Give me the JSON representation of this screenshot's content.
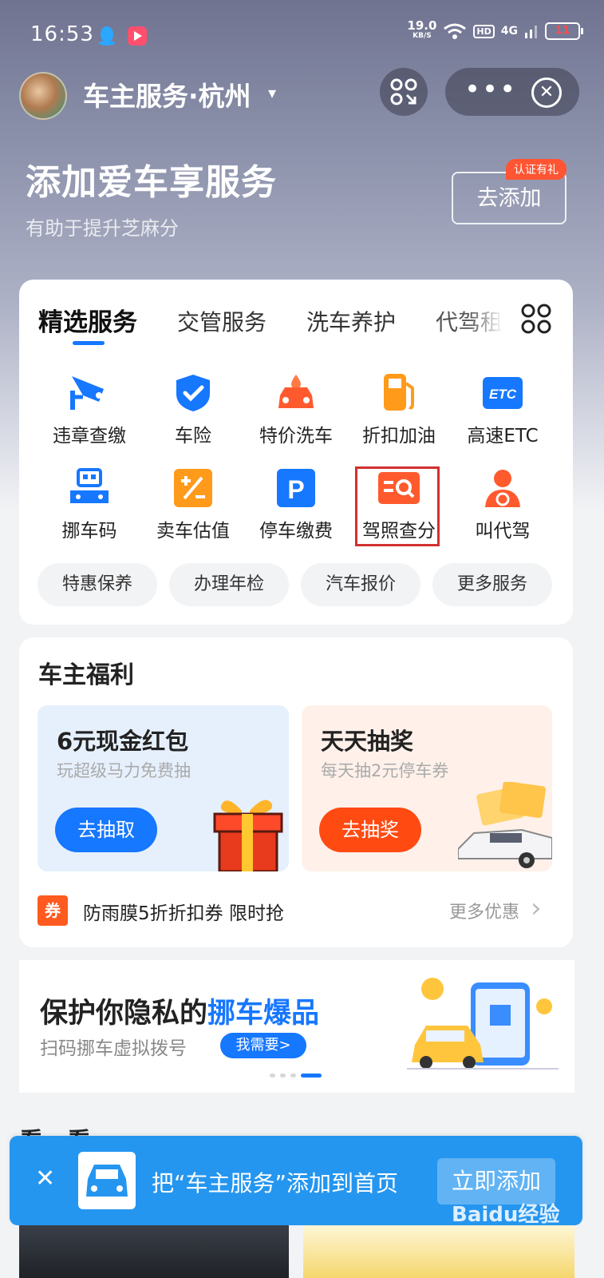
{
  "status_bar": {
    "time": "16:53",
    "net_speed": "19.0",
    "net_unit": "KB/S",
    "hd": "HD",
    "signal": "4G",
    "battery": "11"
  },
  "header": {
    "title": "车主服务·杭州",
    "caret": "▾",
    "more_label": "•••",
    "close_label": "✕"
  },
  "hero": {
    "title": "添加爱车享服务",
    "subtitle": "有助于提升芝麻分",
    "add_button": "去添加",
    "badge": "认证有礼"
  },
  "services_card": {
    "tabs": [
      {
        "label": "精选服务",
        "active": true
      },
      {
        "label": "交管服务",
        "active": false
      },
      {
        "label": "洗车养护",
        "active": false
      },
      {
        "label": "代驾租",
        "active": false
      }
    ],
    "services": [
      {
        "label": "违章查缴",
        "icon": "camera-icon",
        "color": "#1677ff"
      },
      {
        "label": "车险",
        "icon": "shield-check-icon",
        "color": "#1677ff"
      },
      {
        "label": "特价洗车",
        "icon": "car-wash-icon",
        "color": "#ff5a2e"
      },
      {
        "label": "折扣加油",
        "icon": "fuel-pump-icon",
        "color": "#ff9a1a"
      },
      {
        "label": "高速ETC",
        "icon": "etc-icon",
        "color": "#1677ff"
      },
      {
        "label": "挪车码",
        "icon": "car-qr-icon",
        "color": "#1677ff"
      },
      {
        "label": "卖车估值",
        "icon": "calculator-icon",
        "color": "#ff9a1a"
      },
      {
        "label": "停车缴费",
        "icon": "parking-icon",
        "color": "#1677ff"
      },
      {
        "label": "驾照查分",
        "icon": "license-search-icon",
        "color": "#ff5a2e"
      },
      {
        "label": "叫代驾",
        "icon": "driver-icon",
        "color": "#ff5a2e"
      }
    ],
    "pills": [
      "特惠保养",
      "办理年检",
      "汽车报价",
      "更多服务"
    ]
  },
  "benefits": {
    "title": "车主福利",
    "left": {
      "title": "6元现金红包",
      "subtitle": "玩超级马力免费抽",
      "button": "去抽取"
    },
    "right": {
      "title": "天天抽奖",
      "subtitle": "每天抽2元停车券",
      "button": "去抽奖"
    },
    "coupon_tag": "券",
    "coupon_text": "防雨膜5折折扣券 限时抢",
    "more_offers": "更多优惠"
  },
  "banner": {
    "title_prefix": "保护你隐私的",
    "title_highlight": "挪车爆品",
    "subtitle": "扫码挪车虚拟拨号",
    "button": "我需要>"
  },
  "section_peek": {
    "title": "看一看"
  },
  "add_bar": {
    "close": "✕",
    "text": "把“车主服务”添加到首页",
    "button": "立即添加",
    "watermark": "Baidu经验"
  },
  "colors": {
    "primary": "#1677ff",
    "accent_orange": "#ff5a2e",
    "highlight_red": "#d23030",
    "add_bar": "#2596f0"
  }
}
